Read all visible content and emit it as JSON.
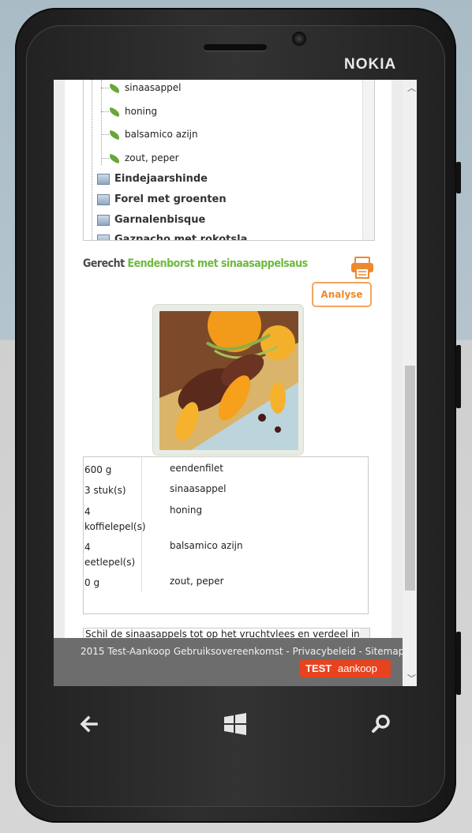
{
  "device": {
    "brand": "NOKIA"
  },
  "tree": {
    "items": [
      {
        "type": "ingredient",
        "label": "sinaasappel"
      },
      {
        "type": "ingredient",
        "label": "honing"
      },
      {
        "type": "ingredient",
        "label": "balsamico azijn"
      },
      {
        "type": "ingredient",
        "label": "zout, peper"
      },
      {
        "type": "recipe",
        "label": "Eindejaarshinde"
      },
      {
        "type": "recipe",
        "label": "Forel met groenten"
      },
      {
        "type": "recipe",
        "label": "Garnalenbisque"
      },
      {
        "type": "recipe",
        "label": "Gazpacho met rokotsla"
      }
    ]
  },
  "recipe": {
    "prefix": "Gerecht",
    "name": "Eendenborst met sinaasappelsaus",
    "analyse_label": "Analyse",
    "print_icon": "printer-icon"
  },
  "ingredients": {
    "rows": [
      {
        "qty": "600 g",
        "name": "eendenfilet"
      },
      {
        "qty": "3 stuk(s)",
        "name": "sinaasappel"
      },
      {
        "qty": "4 koffielepel(s)",
        "name": "honing"
      },
      {
        "qty": "4 eetlepel(s)",
        "name": "balsamico azijn"
      },
      {
        "qty": "0 g",
        "name": "zout, peper"
      }
    ]
  },
  "instructions": {
    "text": "Schil de sinaasappels tot op het vruchtvlees en verdeel in"
  },
  "footer": {
    "text": "2015 Test-Aankoop Gebruiksovereenkomst - Privacybeleid - Sitemap",
    "logo_left": "TEST",
    "logo_right": "aankoop"
  },
  "colors": {
    "accent_green": "#6cbb3c",
    "accent_orange": "#ee8a2e",
    "logo_red": "#e8431f"
  }
}
